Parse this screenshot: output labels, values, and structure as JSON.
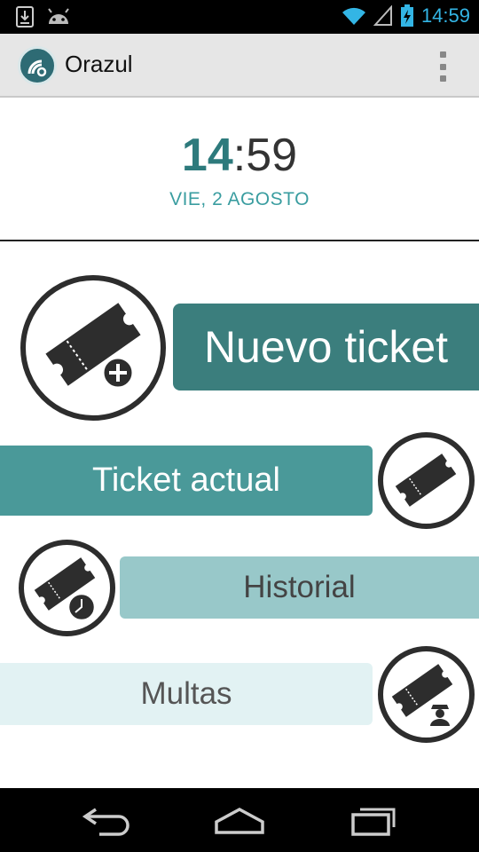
{
  "status_bar": {
    "time": "14:59"
  },
  "action_bar": {
    "title": "Orazul",
    "logo_icon": "orazul-logo-icon",
    "menu_icon": "overflow-menu-icon"
  },
  "clock": {
    "hours": "14",
    "separator": ":",
    "minutes": "59",
    "date": "VIE, 2 AGOSTO"
  },
  "menu": {
    "new_ticket": "Nuevo ticket",
    "current_ticket": "Ticket actual",
    "history": "Historial",
    "fines": "Multas"
  },
  "colors": {
    "dark_teal": "#3b7e7d",
    "teal": "#4a9999",
    "light_teal": "#98c8c9",
    "pale_teal": "#e2f2f3",
    "status_blue": "#33b5e5"
  }
}
